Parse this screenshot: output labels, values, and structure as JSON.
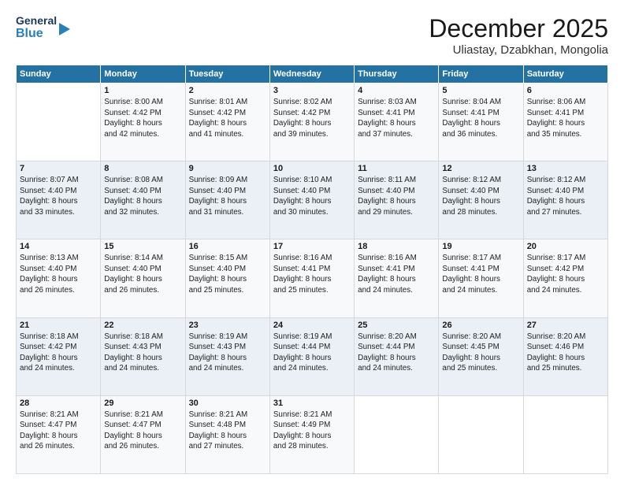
{
  "header": {
    "logo_line1": "General",
    "logo_line2": "Blue",
    "month_title": "December 2025",
    "location": "Uliastay, Dzabkhan, Mongolia"
  },
  "days_of_week": [
    "Sunday",
    "Monday",
    "Tuesday",
    "Wednesday",
    "Thursday",
    "Friday",
    "Saturday"
  ],
  "weeks": [
    [
      {
        "day": "",
        "info": ""
      },
      {
        "day": "1",
        "info": "Sunrise: 8:00 AM\nSunset: 4:42 PM\nDaylight: 8 hours\nand 42 minutes."
      },
      {
        "day": "2",
        "info": "Sunrise: 8:01 AM\nSunset: 4:42 PM\nDaylight: 8 hours\nand 41 minutes."
      },
      {
        "day": "3",
        "info": "Sunrise: 8:02 AM\nSunset: 4:42 PM\nDaylight: 8 hours\nand 39 minutes."
      },
      {
        "day": "4",
        "info": "Sunrise: 8:03 AM\nSunset: 4:41 PM\nDaylight: 8 hours\nand 37 minutes."
      },
      {
        "day": "5",
        "info": "Sunrise: 8:04 AM\nSunset: 4:41 PM\nDaylight: 8 hours\nand 36 minutes."
      },
      {
        "day": "6",
        "info": "Sunrise: 8:06 AM\nSunset: 4:41 PM\nDaylight: 8 hours\nand 35 minutes."
      }
    ],
    [
      {
        "day": "7",
        "info": "Sunrise: 8:07 AM\nSunset: 4:40 PM\nDaylight: 8 hours\nand 33 minutes."
      },
      {
        "day": "8",
        "info": "Sunrise: 8:08 AM\nSunset: 4:40 PM\nDaylight: 8 hours\nand 32 minutes."
      },
      {
        "day": "9",
        "info": "Sunrise: 8:09 AM\nSunset: 4:40 PM\nDaylight: 8 hours\nand 31 minutes."
      },
      {
        "day": "10",
        "info": "Sunrise: 8:10 AM\nSunset: 4:40 PM\nDaylight: 8 hours\nand 30 minutes."
      },
      {
        "day": "11",
        "info": "Sunrise: 8:11 AM\nSunset: 4:40 PM\nDaylight: 8 hours\nand 29 minutes."
      },
      {
        "day": "12",
        "info": "Sunrise: 8:12 AM\nSunset: 4:40 PM\nDaylight: 8 hours\nand 28 minutes."
      },
      {
        "day": "13",
        "info": "Sunrise: 8:12 AM\nSunset: 4:40 PM\nDaylight: 8 hours\nand 27 minutes."
      }
    ],
    [
      {
        "day": "14",
        "info": "Sunrise: 8:13 AM\nSunset: 4:40 PM\nDaylight: 8 hours\nand 26 minutes."
      },
      {
        "day": "15",
        "info": "Sunrise: 8:14 AM\nSunset: 4:40 PM\nDaylight: 8 hours\nand 26 minutes."
      },
      {
        "day": "16",
        "info": "Sunrise: 8:15 AM\nSunset: 4:40 PM\nDaylight: 8 hours\nand 25 minutes."
      },
      {
        "day": "17",
        "info": "Sunrise: 8:16 AM\nSunset: 4:41 PM\nDaylight: 8 hours\nand 25 minutes."
      },
      {
        "day": "18",
        "info": "Sunrise: 8:16 AM\nSunset: 4:41 PM\nDaylight: 8 hours\nand 24 minutes."
      },
      {
        "day": "19",
        "info": "Sunrise: 8:17 AM\nSunset: 4:41 PM\nDaylight: 8 hours\nand 24 minutes."
      },
      {
        "day": "20",
        "info": "Sunrise: 8:17 AM\nSunset: 4:42 PM\nDaylight: 8 hours\nand 24 minutes."
      }
    ],
    [
      {
        "day": "21",
        "info": "Sunrise: 8:18 AM\nSunset: 4:42 PM\nDaylight: 8 hours\nand 24 minutes."
      },
      {
        "day": "22",
        "info": "Sunrise: 8:18 AM\nSunset: 4:43 PM\nDaylight: 8 hours\nand 24 minutes."
      },
      {
        "day": "23",
        "info": "Sunrise: 8:19 AM\nSunset: 4:43 PM\nDaylight: 8 hours\nand 24 minutes."
      },
      {
        "day": "24",
        "info": "Sunrise: 8:19 AM\nSunset: 4:44 PM\nDaylight: 8 hours\nand 24 minutes."
      },
      {
        "day": "25",
        "info": "Sunrise: 8:20 AM\nSunset: 4:44 PM\nDaylight: 8 hours\nand 24 minutes."
      },
      {
        "day": "26",
        "info": "Sunrise: 8:20 AM\nSunset: 4:45 PM\nDaylight: 8 hours\nand 25 minutes."
      },
      {
        "day": "27",
        "info": "Sunrise: 8:20 AM\nSunset: 4:46 PM\nDaylight: 8 hours\nand 25 minutes."
      }
    ],
    [
      {
        "day": "28",
        "info": "Sunrise: 8:21 AM\nSunset: 4:47 PM\nDaylight: 8 hours\nand 26 minutes."
      },
      {
        "day": "29",
        "info": "Sunrise: 8:21 AM\nSunset: 4:47 PM\nDaylight: 8 hours\nand 26 minutes."
      },
      {
        "day": "30",
        "info": "Sunrise: 8:21 AM\nSunset: 4:48 PM\nDaylight: 8 hours\nand 27 minutes."
      },
      {
        "day": "31",
        "info": "Sunrise: 8:21 AM\nSunset: 4:49 PM\nDaylight: 8 hours\nand 28 minutes."
      },
      {
        "day": "",
        "info": ""
      },
      {
        "day": "",
        "info": ""
      },
      {
        "day": "",
        "info": ""
      }
    ]
  ]
}
